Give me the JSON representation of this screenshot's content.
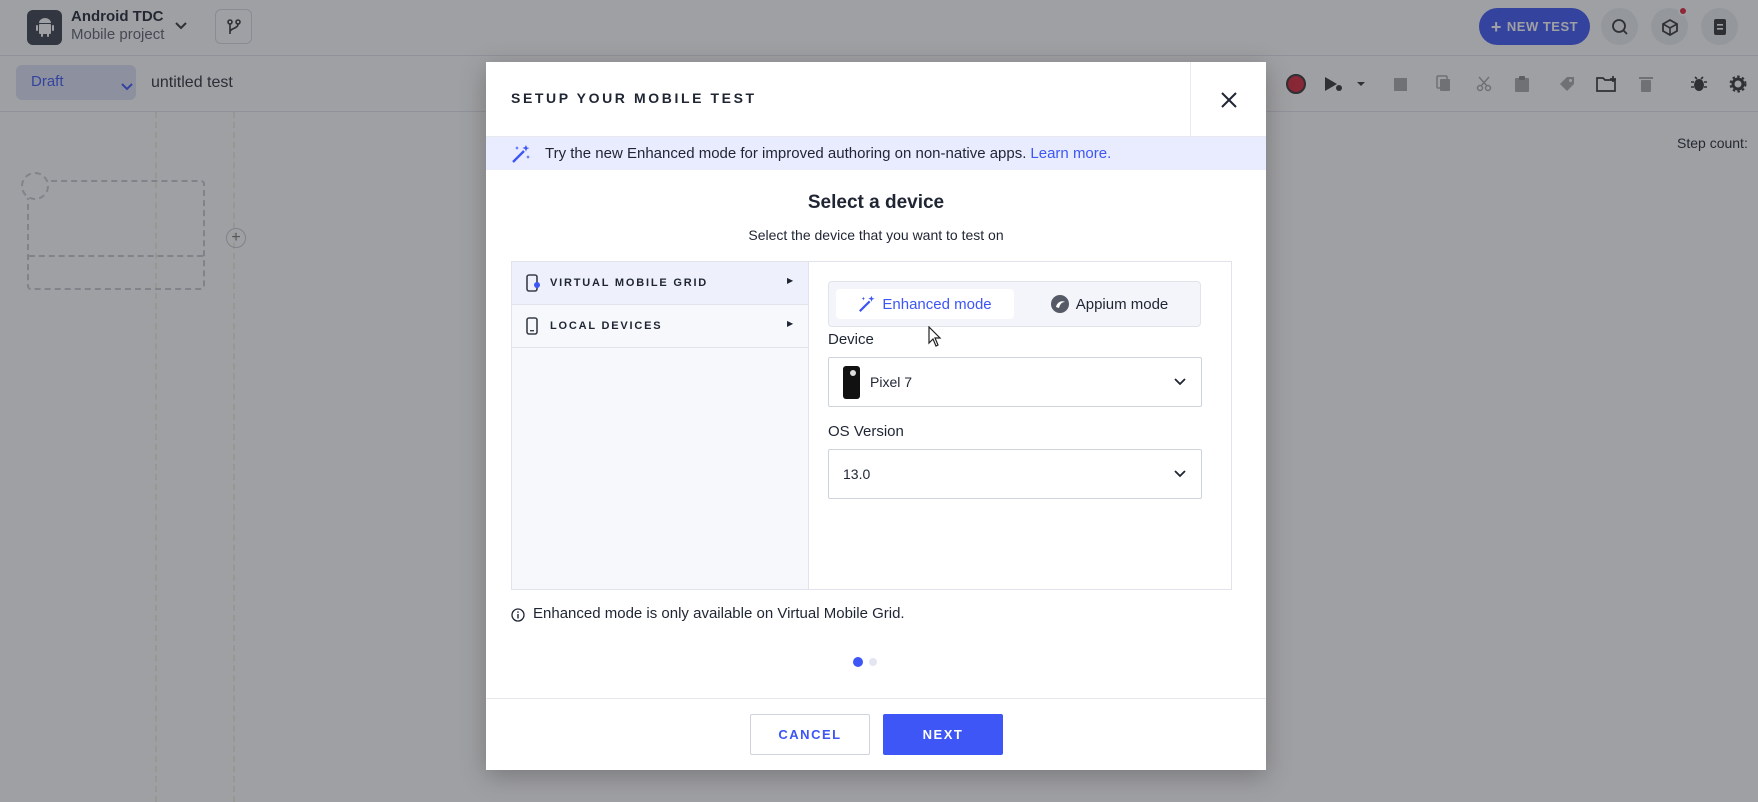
{
  "app": {
    "project_title": "Android TDC",
    "project_subtitle": "Mobile project",
    "new_test_label": "NEW TEST",
    "status_select": "Draft",
    "test_name": "untitled test",
    "step_count_label": "Step count:"
  },
  "modal": {
    "title": "SETUP YOUR MOBILE TEST",
    "banner_text": "Try the new Enhanced mode for improved authoring on non-native apps.",
    "banner_link": "Learn more.",
    "heading": "Select a device",
    "subheading": "Select the device that you want to test on",
    "device_groups": [
      {
        "label": "VIRTUAL MOBILE GRID",
        "icon": "virtual-device-icon",
        "active": true
      },
      {
        "label": "LOCAL DEVICES",
        "icon": "phone-icon",
        "active": false
      }
    ],
    "modes": {
      "enhanced": "Enhanced mode",
      "appium": "Appium mode",
      "selected": "Enhanced mode"
    },
    "device_label": "Device",
    "device_value": "Pixel 7",
    "os_label": "OS Version",
    "os_value": "13.0",
    "info_text": "Enhanced mode is only available on Virtual Mobile Grid.",
    "pagination": {
      "current": 1,
      "total": 2
    },
    "cancel_label": "CANCEL",
    "next_label": "NEXT"
  },
  "colors": {
    "accent": "#3d56f5",
    "banner_bg": "#e8ecfe",
    "record": "#d6243a"
  }
}
